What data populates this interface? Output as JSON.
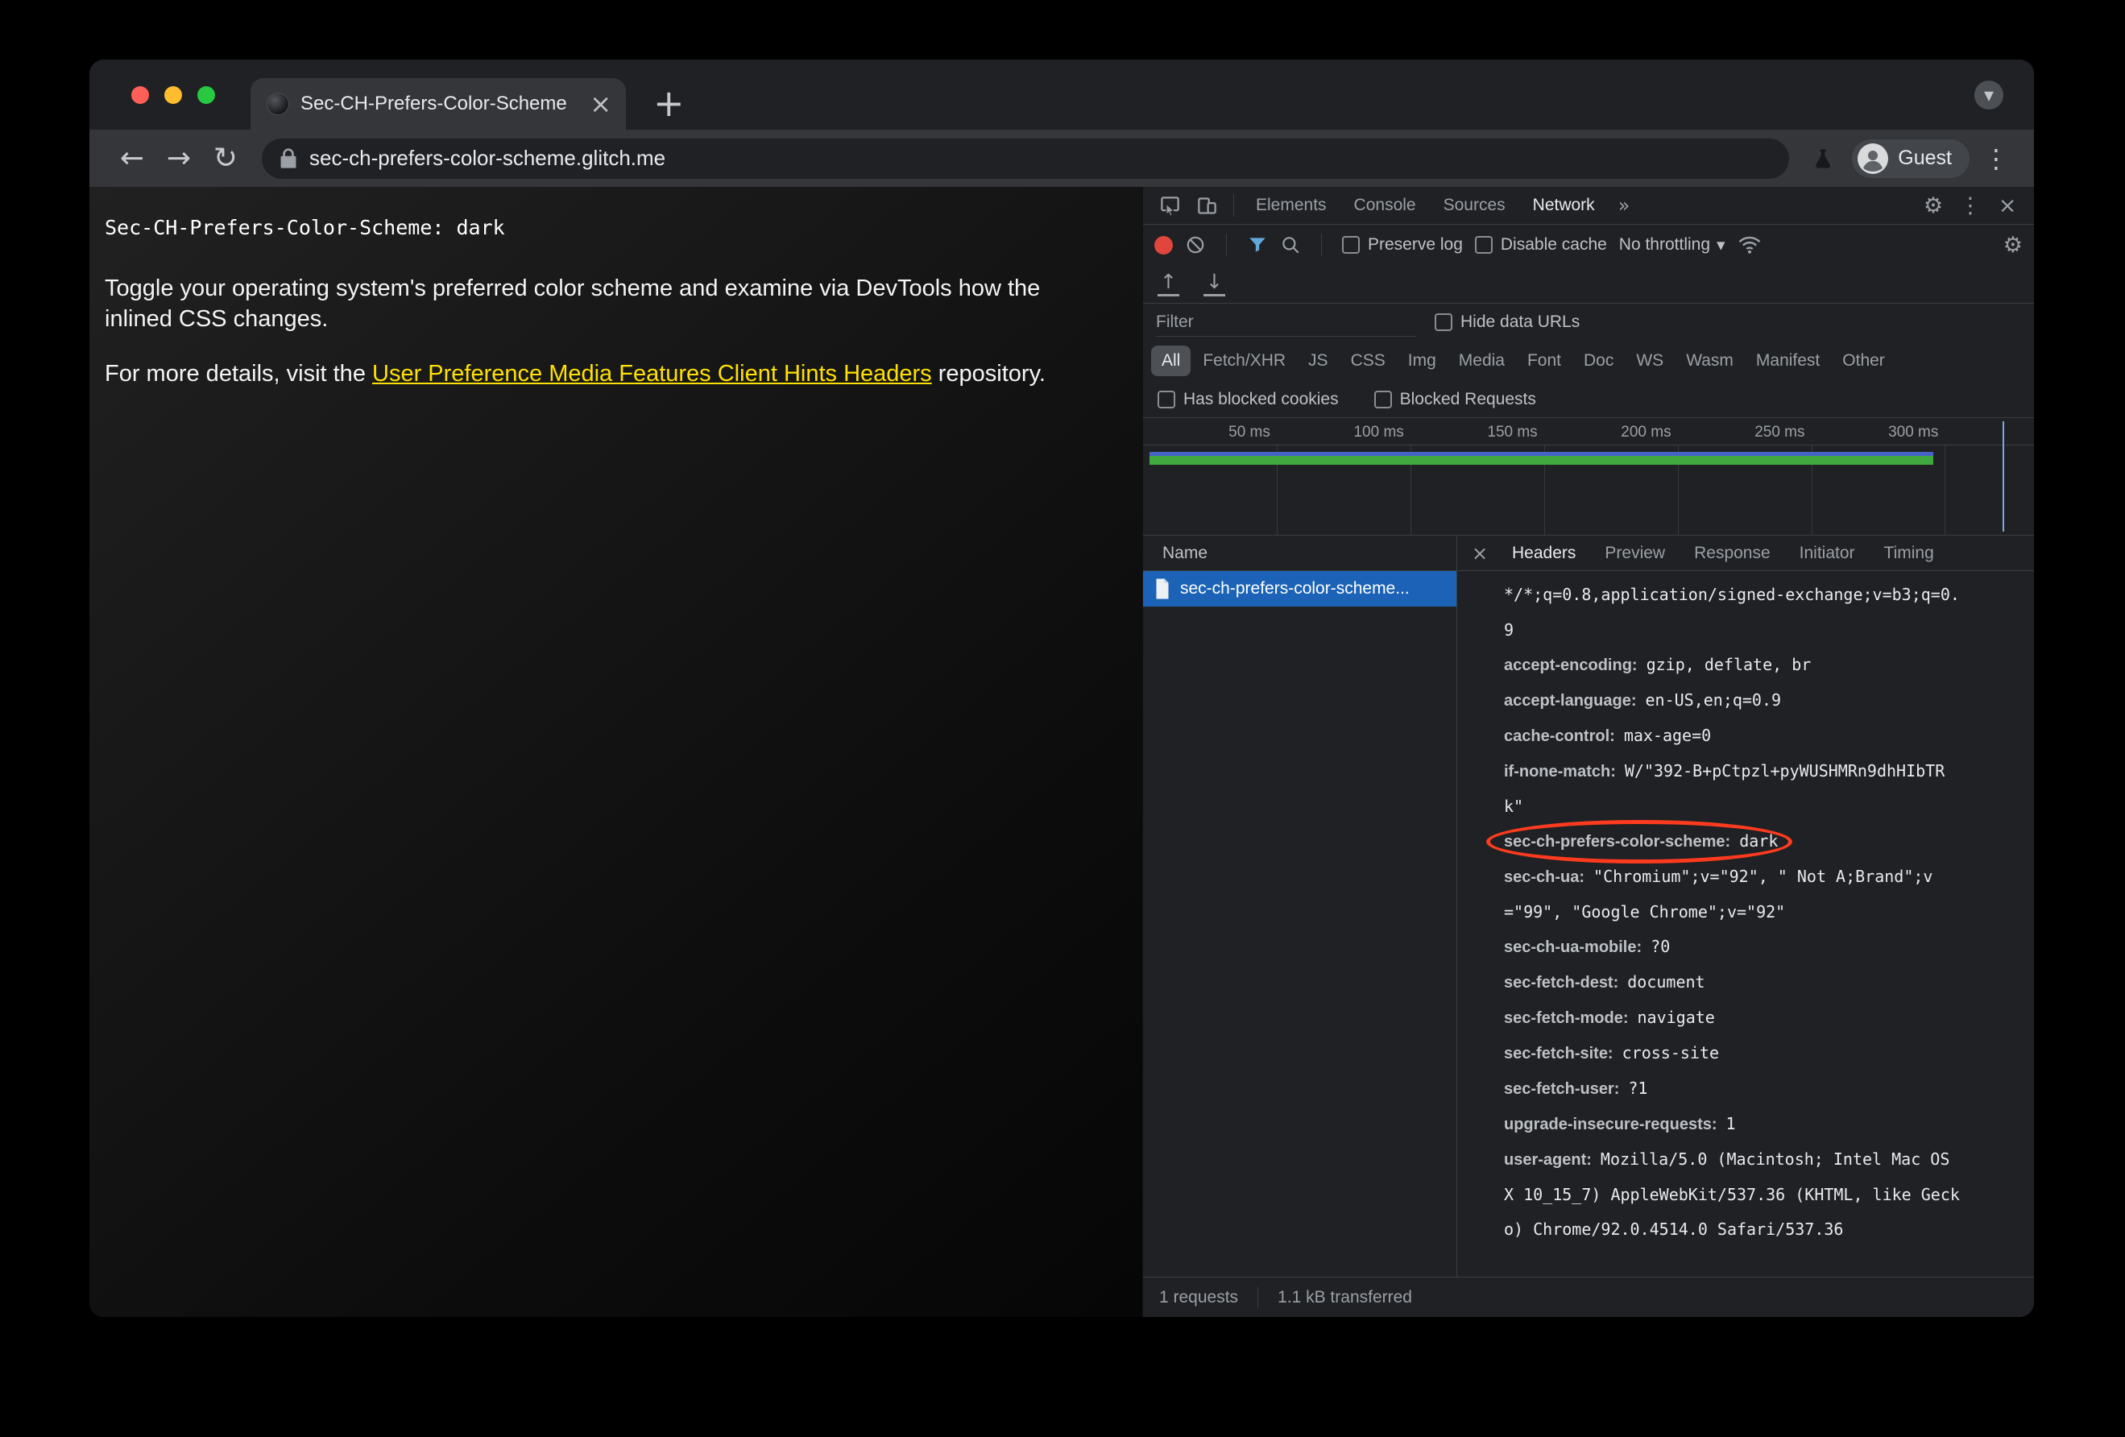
{
  "window": {
    "tab_title": "Sec-CH-Prefers-Color-Scheme",
    "url": "sec-ch-prefers-color-scheme.glitch.me",
    "profile_label": "Guest"
  },
  "icons": {
    "tab_close": "×",
    "new_tab": "+",
    "tab_search_chevron": "▾",
    "back": "←",
    "forward": "→",
    "reload": "↻",
    "kebab": "⋮",
    "gear": "⚙",
    "more_tabs": "»",
    "throttle_caret": "▾",
    "har_import": "↑",
    "har_export": "↓",
    "close": "×"
  },
  "colors": {
    "link_yellow": "#ffe100",
    "annotation_red": "#ff3b1f",
    "selected_row_blue": "#1c63b7",
    "record_red": "#e0463c",
    "timeline_green": "#41a83f",
    "timeline_blue": "#4664c8"
  },
  "page": {
    "code_line": "Sec-CH-Prefers-Color-Scheme: dark",
    "paragraph1": "Toggle your operating system's preferred color scheme and examine via DevTools how the inlined CSS changes.",
    "paragraph2_prefix": "For more details, visit the ",
    "paragraph2_link_text": "User Preference Media Features Client Hints Headers",
    "paragraph2_suffix": " repository."
  },
  "devtools": {
    "main_tabs": [
      {
        "label": "Elements"
      },
      {
        "label": "Console"
      },
      {
        "label": "Sources"
      },
      {
        "label": "Network"
      }
    ],
    "active_main_tab": "Network",
    "network_toolbar": {
      "preserve_log_label": "Preserve log",
      "disable_cache_label": "Disable cache",
      "throttling_value": "No throttling"
    },
    "filter_bar": {
      "filter_placeholder": "Filter",
      "hide_data_urls_label": "Hide data URLs",
      "type_chips": [
        "All",
        "Fetch/XHR",
        "JS",
        "CSS",
        "Img",
        "Media",
        "Font",
        "Doc",
        "WS",
        "Wasm",
        "Manifest",
        "Other"
      ],
      "active_chip": "All",
      "has_blocked_cookies_label": "Has blocked cookies",
      "blocked_requests_label": "Blocked Requests"
    },
    "timeline": {
      "ticks": [
        "50 ms",
        "100 ms",
        "150 ms",
        "200 ms",
        "250 ms",
        "300 ms"
      ]
    },
    "request_list": {
      "name_column_header": "Name",
      "selected_request": "sec-ch-prefers-color-scheme..."
    },
    "detail_tabs": [
      {
        "label": "Headers"
      },
      {
        "label": "Preview"
      },
      {
        "label": "Response"
      },
      {
        "label": "Initiator"
      },
      {
        "label": "Timing"
      }
    ],
    "active_detail_tab": "Headers",
    "headers": [
      {
        "name": "",
        "value": "*/*;q=0.8,application/signed-exchange;v=b3;q=0.9"
      },
      {
        "name": "accept-encoding:",
        "value": "gzip, deflate, br"
      },
      {
        "name": "accept-language:",
        "value": "en-US,en;q=0.9"
      },
      {
        "name": "cache-control:",
        "value": "max-age=0"
      },
      {
        "name": "if-none-match:",
        "value": "W/\"392-B+pCtpzl+pyWUSHMRn9dhHIbTRk\""
      },
      {
        "name": "sec-ch-prefers-color-scheme:",
        "value": "dark"
      },
      {
        "name": "sec-ch-ua:",
        "value": "\"Chromium\";v=\"92\", \" Not A;Brand\";v=\"99\", \"Google Chrome\";v=\"92\""
      },
      {
        "name": "sec-ch-ua-mobile:",
        "value": "?0"
      },
      {
        "name": "sec-fetch-dest:",
        "value": "document"
      },
      {
        "name": "sec-fetch-mode:",
        "value": "navigate"
      },
      {
        "name": "sec-fetch-site:",
        "value": "cross-site"
      },
      {
        "name": "sec-fetch-user:",
        "value": "?1"
      },
      {
        "name": "upgrade-insecure-requests:",
        "value": "1"
      },
      {
        "name": "user-agent:",
        "value": "Mozilla/5.0 (Macintosh; Intel Mac OS X 10_15_7) AppleWebKit/537.36 (KHTML, like Gecko) Chrome/92.0.4514.0 Safari/537.36"
      }
    ],
    "status_bar": {
      "requests_count": "1 requests",
      "transferred": "1.1 kB transferred"
    }
  }
}
